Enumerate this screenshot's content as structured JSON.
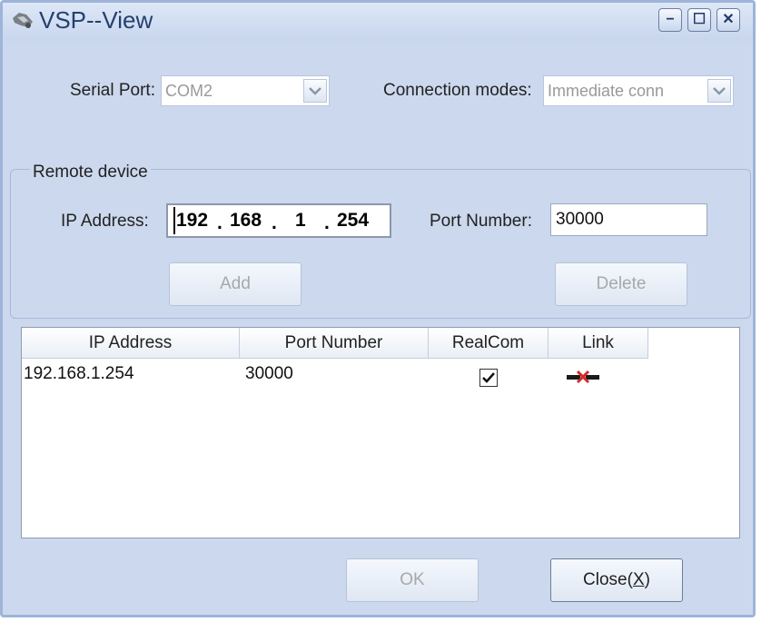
{
  "window": {
    "title": "VSP--View"
  },
  "serial_port": {
    "label": "Serial Port:",
    "value": "COM2"
  },
  "connection_mode": {
    "label": "Connection modes:",
    "value": "Immediate conn"
  },
  "remote_device": {
    "group_title": "Remote device",
    "ip_label": "IP Address:",
    "ip_octets": [
      "192",
      "168",
      "1",
      "254"
    ],
    "port_label": "Port Number:",
    "port_value": "30000",
    "add_label": "Add",
    "delete_label": "Delete"
  },
  "table": {
    "columns": [
      "IP Address",
      "Port Number",
      "RealCom",
      "Link"
    ],
    "rows": [
      {
        "ip": "192.168.1.254",
        "port": "30000",
        "realcom": true,
        "link_icon": "disconnected-link-icon"
      }
    ]
  },
  "footer": {
    "ok_label": "OK",
    "close_label": "Close",
    "close_key": "X"
  },
  "colors": {
    "window_bg": "#ccd8ee",
    "title_text": "#24416e",
    "disabled_text": "#a8a8a8"
  }
}
